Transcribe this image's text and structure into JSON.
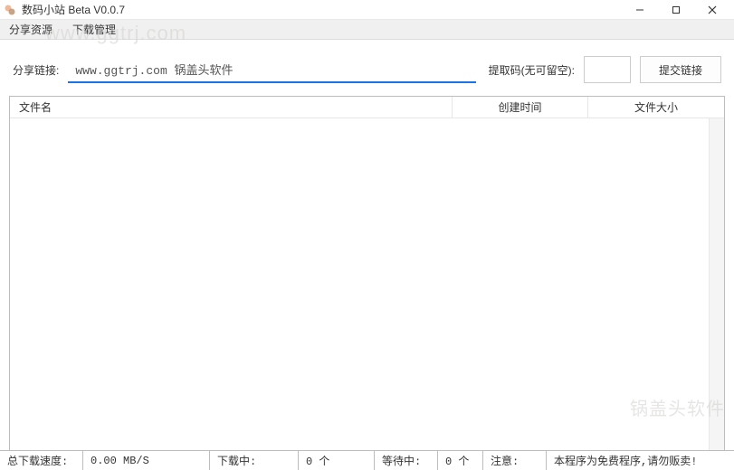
{
  "window": {
    "title": "数码小站 Beta V0.0.7"
  },
  "menu": {
    "share_resource": "分享资源",
    "download_manage": "下载管理"
  },
  "input": {
    "share_label": "分享链接:",
    "share_value": "www.ggtrj.com 锅盖头软件",
    "code_label": "提取码(无可留空):",
    "code_value": "",
    "submit_label": "提交链接"
  },
  "table": {
    "headers": {
      "filename": "文件名",
      "create_time": "创建时间",
      "file_size": "文件大小"
    }
  },
  "status": {
    "speed_label": "总下载速度:",
    "speed_value": "0.00 MB/S",
    "downloading_label": "下载中:",
    "downloading_value": "0 个",
    "waiting_label": "等待中:",
    "waiting_value": "0 个",
    "notice_label": "注意:",
    "notice_text": "本程序为免费程序,请勿贩卖!"
  },
  "watermark": {
    "text1": "www.ggtrj.com",
    "text2": "锅盖头软件"
  }
}
